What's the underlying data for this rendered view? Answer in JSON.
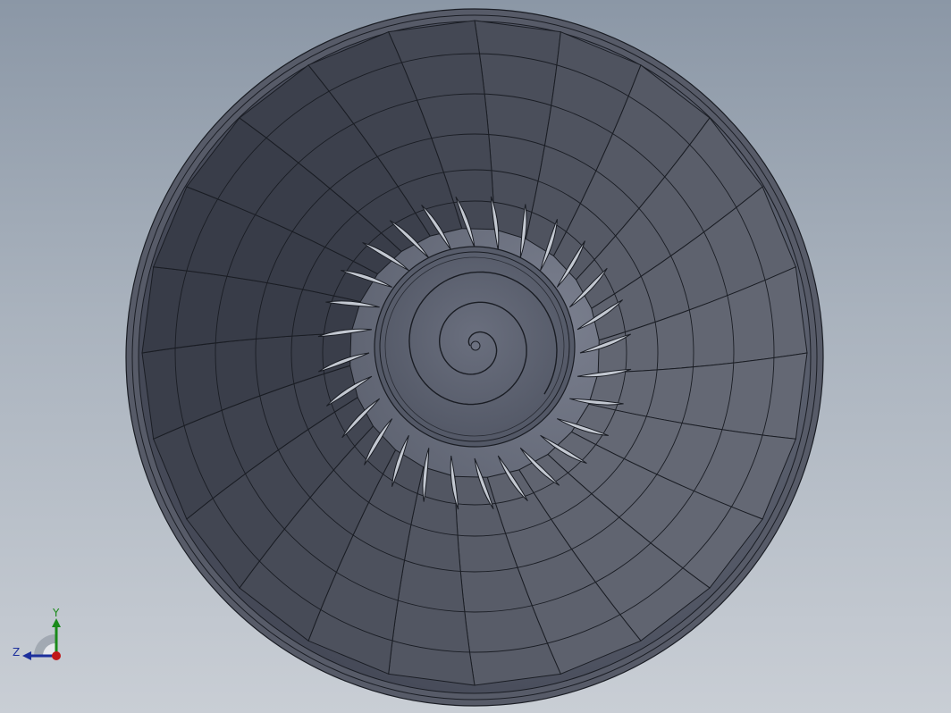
{
  "viewport": {
    "background_top": "#8b97a6",
    "background_bottom": "#c9ced5"
  },
  "model": {
    "name": "turbofan-fan-assembly",
    "face_color": "#5a5f6d",
    "edge_color": "#1a1d24",
    "fan_blade_count": 24,
    "inner_vane_count": 28
  },
  "triad": {
    "y_label": "Y",
    "z_label": "Z",
    "y_color": "#1a8a1a",
    "z_color": "#1c2f9c",
    "x_color": "#c01818"
  }
}
